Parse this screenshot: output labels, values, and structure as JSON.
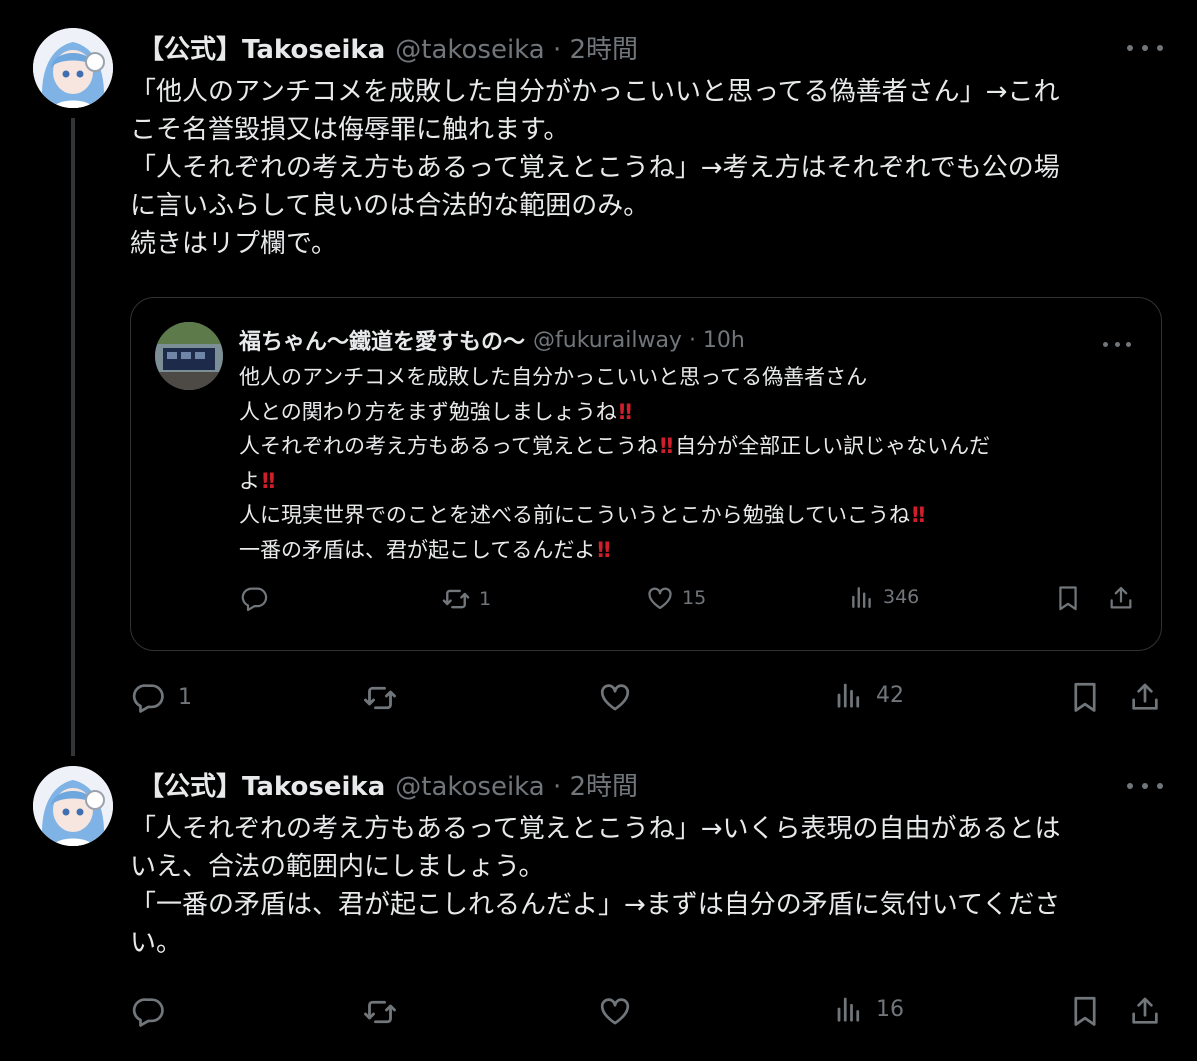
{
  "tweets": [
    {
      "author_name": "【公式】Takoseika",
      "author_handle": "@takoseika · 2時間",
      "avatar": "anime-avatar",
      "text_lines": [
        "「他人のアンチコメを成敗した自分がかっこいいと思ってる偽善者さん」→これ",
        "こそ名誉毀損又は侮辱罪に触れます。",
        "「人それぞれの考え方もあるって覚えとこうね」→考え方はそれぞれでも公の場",
        "に言いふらして良いのは合法的な範囲のみ。",
        "続きはリプ欄で。"
      ],
      "quote": {
        "author_name": "福ちゃん〜鐵道を愛すもの〜",
        "author_handle": "@fukurailway · 10h",
        "avatar": "train-photo-avatar",
        "emphasis": "‼",
        "lines": [
          {
            "text": "他人のアンチコメを成敗した自分かっこいいと思ってる偽善者さん",
            "after": ""
          },
          {
            "text": "人との関わり方をまず勉強しましょうね",
            "after": ""
          },
          {
            "text": "人それぞれの考え方もあるって覚えとこうね",
            "after": "自分が全部正しい訳じゃないんだ"
          },
          {
            "text": "よ",
            "after": ""
          },
          {
            "text": "人に現実世界でのことを述べる前にこういうとこから勉強していこうね",
            "after": ""
          },
          {
            "text": "一番の矛盾は、君が起こしてるんだよ",
            "after": ""
          }
        ],
        "metrics": {
          "replies": "",
          "reposts": "1",
          "likes": "15",
          "views": "346"
        }
      },
      "metrics": {
        "replies": "1",
        "reposts": "",
        "likes": "",
        "views": "42"
      }
    },
    {
      "author_name": "【公式】Takoseika",
      "author_handle": "@takoseika · 2時間",
      "avatar": "anime-avatar",
      "text_lines": [
        "「人それぞれの考え方もあるって覚えとこうね」→いくら表現の自由があるとは",
        "いえ、合法の範囲内にしましょう。",
        "「一番の矛盾は、君が起こしれるんだよ」→まずは自分の矛盾に気付いてくださ",
        "い。"
      ],
      "metrics": {
        "replies": "",
        "reposts": "",
        "likes": "",
        "views": "16"
      }
    }
  ],
  "colors": {
    "background": "#000000",
    "text": "#e7e9ea",
    "muted": "#71767b",
    "border": "#2f3336",
    "emphasis": "#d01f2b"
  },
  "icons": [
    "reply-icon",
    "repost-icon",
    "like-icon",
    "views-icon",
    "bookmark-icon",
    "share-icon",
    "more-icon"
  ]
}
